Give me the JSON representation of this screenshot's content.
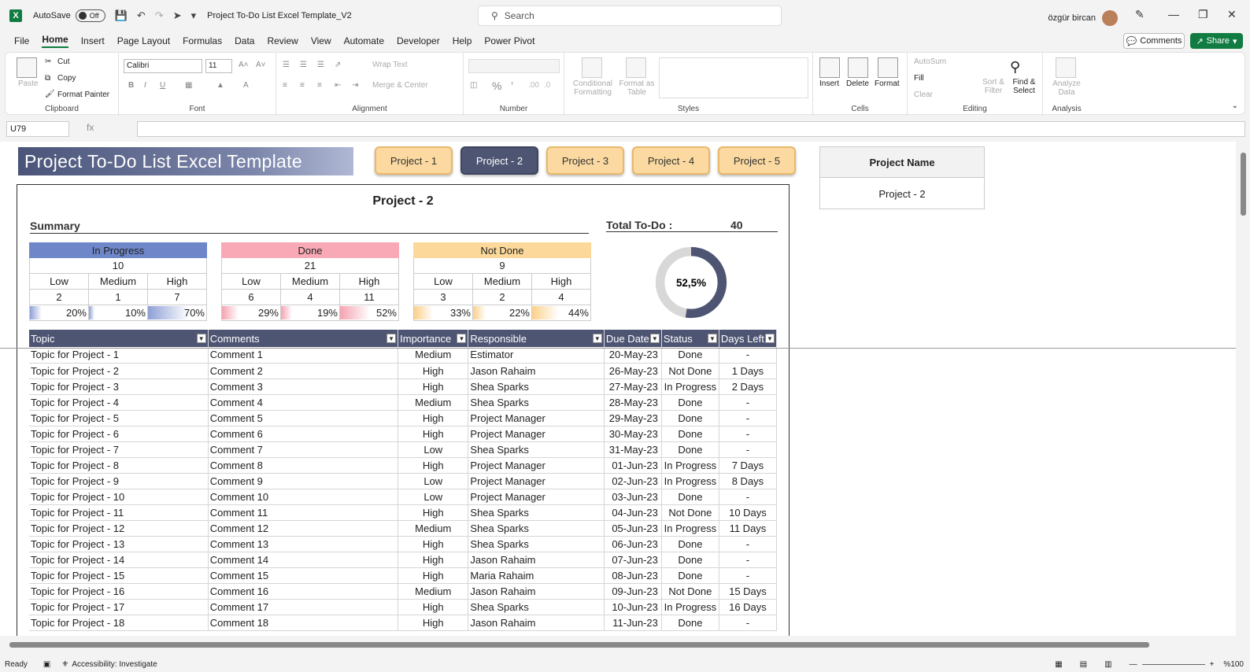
{
  "titlebar": {
    "logo": "X",
    "autosave_label": "AutoSave",
    "autosave_state": "Off",
    "doc_title": "Project To-Do List Excel Template_V2",
    "search_placeholder": "Search",
    "user_name": "özgür bircan"
  },
  "menu": [
    "File",
    "Home",
    "Insert",
    "Page Layout",
    "Formulas",
    "Data",
    "Review",
    "View",
    "Automate",
    "Developer",
    "Help",
    "Power Pivot"
  ],
  "menu_active": "Home",
  "comments_label": "Comments",
  "share_label": "Share",
  "ribbon": {
    "clipboard": {
      "paste": "Paste",
      "cut": "Cut",
      "copy": "Copy",
      "format_painter": "Format Painter",
      "label": "Clipboard"
    },
    "font": {
      "name": "Calibri",
      "size": "11",
      "label": "Font"
    },
    "alignment": {
      "wrap": "Wrap Text",
      "merge": "Merge & Center",
      "label": "Alignment"
    },
    "number": {
      "label": "Number"
    },
    "styles": {
      "conditional": "Conditional Formatting",
      "format_table": "Format as Table",
      "label": "Styles"
    },
    "cells": {
      "insert": "Insert",
      "delete": "Delete",
      "format": "Format",
      "label": "Cells"
    },
    "editing": {
      "autosum": "AutoSum",
      "fill": "Fill",
      "clear": "Clear",
      "sort": "Sort & Filter",
      "find": "Find & Select",
      "label": "Editing"
    },
    "analysis": {
      "analyze": "Analyze Data",
      "label": "Analysis"
    }
  },
  "formula": {
    "cell_ref": "U79",
    "fx": "fx",
    "value": ""
  },
  "sheet": {
    "banner": "Project To-Do List Excel Template",
    "project_buttons": [
      "Project - 1",
      "Project - 2",
      "Project - 3",
      "Project - 4",
      "Project - 5"
    ],
    "active_project_index": 1,
    "project_name_label": "Project Name",
    "project_name_value": "Project - 2",
    "project_title": "Project - 2",
    "summary_label": "Summary",
    "total_label": "Total To-Do :",
    "total_value": "40",
    "donut_value": "52,5%",
    "donut_fraction": 0.525,
    "summary_blocks": [
      {
        "name": "In Progress",
        "count": "10",
        "color": "#6f86c8",
        "fill": "#8ea0d6",
        "levels": [
          "Low",
          "Medium",
          "High"
        ],
        "counts": [
          "2",
          "1",
          "7"
        ],
        "pcts": [
          "20%",
          "10%",
          "70%"
        ],
        "frac": [
          0.2,
          0.1,
          0.7
        ]
      },
      {
        "name": "Done",
        "count": "21",
        "color": "#f8a9b5",
        "fill": "#f5a3b1",
        "levels": [
          "Low",
          "Medium",
          "High"
        ],
        "counts": [
          "6",
          "4",
          "11"
        ],
        "pcts": [
          "29%",
          "19%",
          "52%"
        ],
        "frac": [
          0.29,
          0.19,
          0.52
        ]
      },
      {
        "name": "Not Done",
        "count": "9",
        "color": "#fcd99a",
        "fill": "#fbd08a",
        "levels": [
          "Low",
          "Medium",
          "High"
        ],
        "counts": [
          "3",
          "2",
          "4"
        ],
        "pcts": [
          "33%",
          "22%",
          "44%"
        ],
        "frac": [
          0.33,
          0.22,
          0.44
        ]
      }
    ],
    "table": {
      "headers": [
        "Topic",
        "Comments",
        "Importance",
        "Responsible",
        "Due Date",
        "Status",
        "Days Left"
      ],
      "rows": [
        [
          "Topic for Project - 1",
          "Comment 1",
          "Medium",
          "Estimator",
          "20-May-23",
          "Done",
          "-"
        ],
        [
          "Topic for Project - 2",
          "Comment 2",
          "High",
          "Jason Rahaim",
          "26-May-23",
          "Not Done",
          "1 Days"
        ],
        [
          "Topic for Project - 3",
          "Comment 3",
          "High",
          "Shea Sparks",
          "27-May-23",
          "In Progress",
          "2 Days"
        ],
        [
          "Topic for Project - 4",
          "Comment 4",
          "Medium",
          "Shea Sparks",
          "28-May-23",
          "Done",
          "-"
        ],
        [
          "Topic for Project - 5",
          "Comment 5",
          "High",
          "Project Manager",
          "29-May-23",
          "Done",
          "-"
        ],
        [
          "Topic for Project - 6",
          "Comment 6",
          "High",
          "Project Manager",
          "30-May-23",
          "Done",
          "-"
        ],
        [
          "Topic for Project - 7",
          "Comment 7",
          "Low",
          "Shea Sparks",
          "31-May-23",
          "Done",
          "-"
        ],
        [
          "Topic for Project - 8",
          "Comment 8",
          "High",
          "Project Manager",
          "01-Jun-23",
          "In Progress",
          "7 Days"
        ],
        [
          "Topic for Project - 9",
          "Comment 9",
          "Low",
          "Project Manager",
          "02-Jun-23",
          "In Progress",
          "8 Days"
        ],
        [
          "Topic for Project - 10",
          "Comment 10",
          "Low",
          "Project Manager",
          "03-Jun-23",
          "Done",
          "-"
        ],
        [
          "Topic for Project - 11",
          "Comment 11",
          "High",
          "Shea Sparks",
          "04-Jun-23",
          "Not Done",
          "10 Days"
        ],
        [
          "Topic for Project - 12",
          "Comment 12",
          "Medium",
          "Shea Sparks",
          "05-Jun-23",
          "In Progress",
          "11 Days"
        ],
        [
          "Topic for Project - 13",
          "Comment 13",
          "High",
          "Shea Sparks",
          "06-Jun-23",
          "Done",
          "-"
        ],
        [
          "Topic for Project - 14",
          "Comment 14",
          "High",
          "Jason Rahaim",
          "07-Jun-23",
          "Done",
          "-"
        ],
        [
          "Topic for Project - 15",
          "Comment 15",
          "High",
          "Maria Rahaim",
          "08-Jun-23",
          "Done",
          "-"
        ],
        [
          "Topic for Project - 16",
          "Comment 16",
          "Medium",
          "Jason Rahaim",
          "09-Jun-23",
          "Not Done",
          "15 Days"
        ],
        [
          "Topic for Project - 17",
          "Comment 17",
          "High",
          "Shea Sparks",
          "10-Jun-23",
          "In Progress",
          "16 Days"
        ],
        [
          "Topic for Project - 18",
          "Comment 18",
          "High",
          "Jason Rahaim",
          "11-Jun-23",
          "Done",
          "-"
        ]
      ]
    }
  },
  "status": {
    "ready": "Ready",
    "accessibility": "Accessibility: Investigate",
    "zoom": "%100"
  },
  "colors": {
    "accent": "#107c41",
    "header": "#4e5573",
    "donut_bg": "#d8d8d8"
  }
}
